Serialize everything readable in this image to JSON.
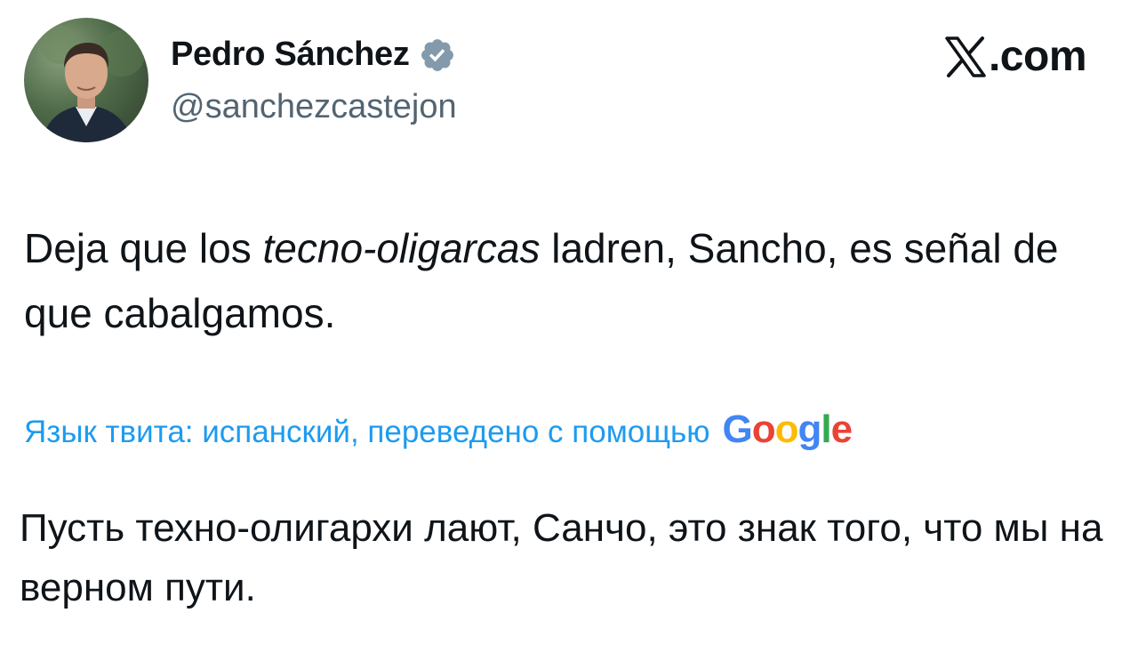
{
  "author": {
    "display_name": "Pedro Sánchez",
    "handle": "@sanchezcastejon",
    "verified": true,
    "verified_color": "#829aab"
  },
  "brand": {
    "label": ".com",
    "icon": "x-logo-icon"
  },
  "tweet": {
    "text_part1": "Deja que los ",
    "text_italic": "tecno-oligarcas",
    "text_part2": " ladren, Sancho, es señal de que cabalgamos."
  },
  "translation": {
    "label": "Язык твита: испанский, переведено с помощью",
    "provider": "Google",
    "text": "Пусть техно-олигархи лают, Санчо, это знак того, что мы на верном пути."
  },
  "colors": {
    "text": "#0f1419",
    "secondary": "#536471",
    "link": "#1d9bf0"
  }
}
